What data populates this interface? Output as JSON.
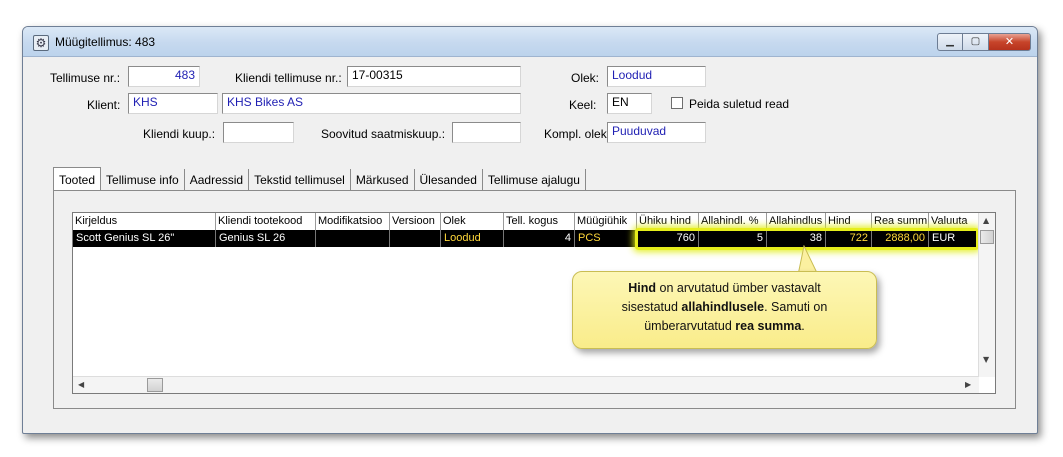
{
  "window": {
    "title": "Müügitellimus: 483",
    "icon": "gear-window-icon",
    "buttons": {
      "minimize": "minimize-icon",
      "maximize": "maximize-icon",
      "close": "close-icon"
    }
  },
  "form": {
    "order_no_label": "Tellimuse nr.:",
    "order_no_value": "483",
    "client_order_no_label": "Kliendi tellimuse nr.:",
    "client_order_no_value": "17-00315",
    "status_label": "Olek:",
    "status_value": "Loodud",
    "client_label": "Klient:",
    "client_code_value": "KHS",
    "client_name_value": "KHS Bikes AS",
    "language_label": "Keel:",
    "language_value": "EN",
    "hide_closed_label": "Peida suletud read",
    "hide_closed_checked": false,
    "client_purchase_label": "Kliendi kuup.:",
    "client_purchase_value": "",
    "desired_delivery_label": "Soovitud saatmiskuup.:",
    "desired_delivery_value": "",
    "complete_status_label": "Kompl. olek:",
    "complete_status_value": "Puuduvad"
  },
  "tabs": [
    {
      "label": "Tooted",
      "active": true
    },
    {
      "label": "Tellimuse info",
      "active": false
    },
    {
      "label": "Aadressid",
      "active": false
    },
    {
      "label": "Tekstid tellimusel",
      "active": false
    },
    {
      "label": "Märkused",
      "active": false
    },
    {
      "label": "Ülesanded",
      "active": false
    },
    {
      "label": "Tellimuse ajalugu",
      "active": false
    }
  ],
  "grid": {
    "columns": [
      "Kirjeldus",
      "Kliendi tootekood",
      "Modifikatsioo",
      "Versioon",
      "Olek",
      "Tell. kogus",
      "Müügiühik",
      "Ühiku hind",
      "Allahindl. %",
      "Allahindlus",
      "Hind",
      "Rea summ",
      "Valuuta"
    ],
    "rows": [
      {
        "description": "Scott Genius SL 26\"",
        "client_code": "Genius SL 26",
        "modification": "",
        "version": "",
        "status": "Loodud",
        "qty": "4",
        "unit": "PCS",
        "unit_price": "760",
        "discount_pct": "5",
        "discount": "38",
        "price": "722",
        "row_sum": "2888,00",
        "currency": "EUR"
      }
    ]
  },
  "callout": {
    "part1_bold": "Hind",
    "part2": " on arvutatud ümber vastavalt",
    "part3": "sisestatud ",
    "part4_bold": "allahindlusele",
    "part5": ". Samuti on",
    "part6": "ümberarvutatud ",
    "part7_bold": "rea summa",
    "part8": "."
  },
  "colors": {
    "highlight": "#e6ee1c",
    "callout_bg": "#fbf1a0",
    "row_bg": "#000000",
    "yellow_text": "#ffd83a",
    "blue_text": "#1f1fb3"
  }
}
